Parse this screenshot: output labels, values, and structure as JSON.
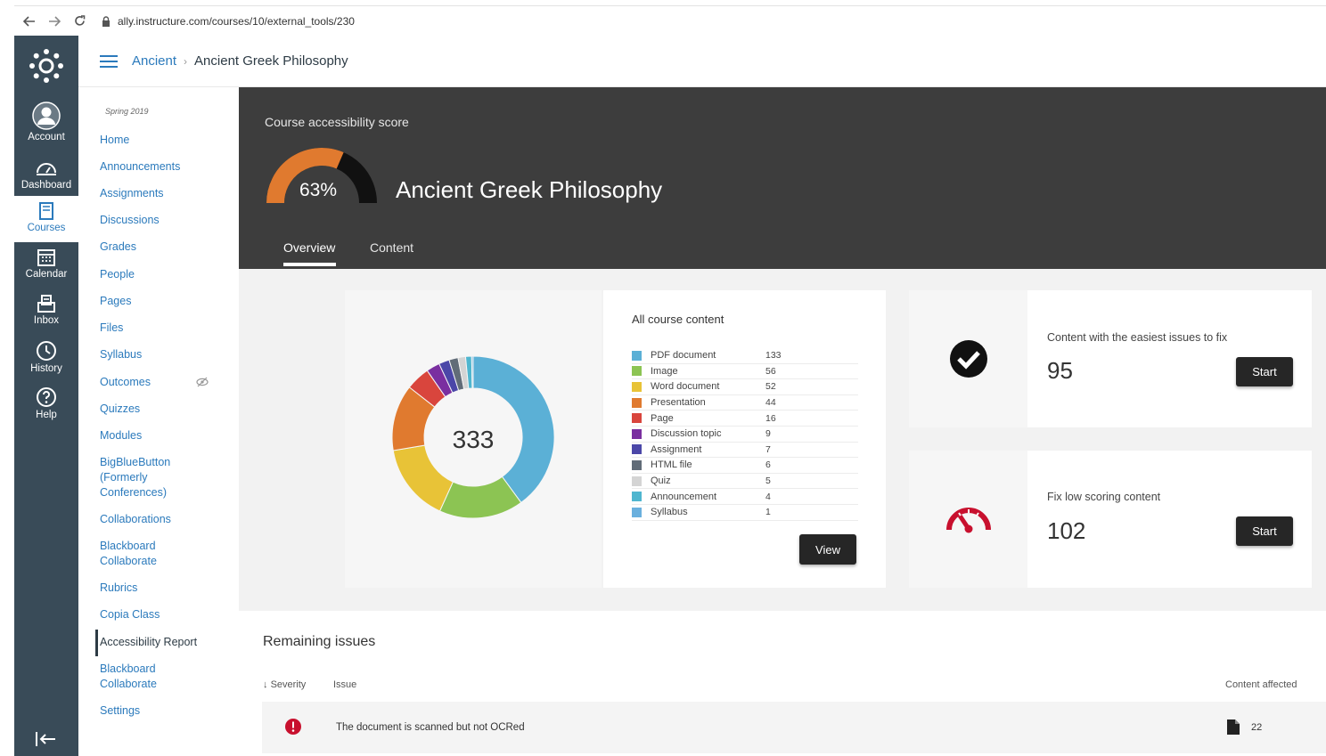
{
  "browser": {
    "url": "ally.instructure.com/courses/10/external_tools/230",
    "back_icon": "back-arrow-icon",
    "forward_icon": "forward-arrow-icon",
    "reload_icon": "reload-icon"
  },
  "global_nav": {
    "items": [
      {
        "label": "Account",
        "icon": "user-icon"
      },
      {
        "label": "Dashboard",
        "icon": "dashboard-icon"
      },
      {
        "label": "Courses",
        "icon": "book-icon",
        "active": true
      },
      {
        "label": "Calendar",
        "icon": "calendar-icon"
      },
      {
        "label": "Inbox",
        "icon": "inbox-icon"
      },
      {
        "label": "History",
        "icon": "clock-icon"
      },
      {
        "label": "Help",
        "icon": "help-icon"
      }
    ]
  },
  "breadcrumb": {
    "course": "Ancient",
    "separator": "›",
    "current": "Ancient Greek Philosophy"
  },
  "course_nav": {
    "term": "Spring 2019",
    "items": [
      {
        "label": "Home"
      },
      {
        "label": "Announcements"
      },
      {
        "label": "Assignments"
      },
      {
        "label": "Discussions"
      },
      {
        "label": "Grades"
      },
      {
        "label": "People"
      },
      {
        "label": "Pages"
      },
      {
        "label": "Files"
      },
      {
        "label": "Syllabus"
      },
      {
        "label": "Outcomes"
      },
      {
        "label": "Quizzes"
      },
      {
        "label": "Modules"
      },
      {
        "label": "BigBlueButton (Formerly Conferences)"
      },
      {
        "label": "Collaborations"
      },
      {
        "label": "Blackboard Collaborate"
      },
      {
        "label": "Rubrics"
      },
      {
        "label": "Copia Class"
      },
      {
        "label": "Accessibility Report",
        "active": true
      },
      {
        "label": "Blackboard Collaborate"
      },
      {
        "label": "Settings"
      }
    ]
  },
  "report": {
    "score_label": "Course accessibility score",
    "score_value": "63%",
    "score_fraction": 0.63,
    "course_title": "Ancient Greek Philosophy",
    "tabs": [
      {
        "label": "Overview",
        "active": true
      },
      {
        "label": "Content"
      }
    ]
  },
  "content_summary": {
    "title": "All course content",
    "total": "333",
    "view_label": "View",
    "items": [
      {
        "name": "PDF document",
        "count": "133",
        "color": "#5bb0d6"
      },
      {
        "name": "Image",
        "count": "56",
        "color": "#8cc453"
      },
      {
        "name": "Word document",
        "count": "52",
        "color": "#e8c337"
      },
      {
        "name": "Presentation",
        "count": "44",
        "color": "#e07a2f"
      },
      {
        "name": "Page",
        "count": "16",
        "color": "#d9453d"
      },
      {
        "name": "Discussion topic",
        "count": "9",
        "color": "#7a2fa0"
      },
      {
        "name": "Assignment",
        "count": "7",
        "color": "#4b47a8"
      },
      {
        "name": "HTML file",
        "count": "6",
        "color": "#616c78"
      },
      {
        "name": "Quiz",
        "count": "5",
        "color": "#d4d4d4"
      },
      {
        "name": "Announcement",
        "count": "4",
        "color": "#4fb6cf"
      },
      {
        "name": "Syllabus",
        "count": "1",
        "color": "#6ab0de"
      }
    ]
  },
  "tasks": [
    {
      "label": "Content with the easiest issues to fix",
      "value": "95",
      "button": "Start",
      "icon": "check-circle-icon"
    },
    {
      "label": "Fix low scoring content",
      "value": "102",
      "button": "Start",
      "icon": "speedometer-icon"
    }
  ],
  "remaining": {
    "title": "Remaining issues",
    "col_severity": "Severity",
    "col_issue": "Issue",
    "col_affected": "Content affected",
    "issues": [
      {
        "text": "The document is scanned but not OCRed",
        "count": "22"
      }
    ]
  },
  "colors": {
    "canvas_nav": "#394b58",
    "link": "#2b7abc",
    "ally_dark": "#3d3d3d",
    "gauge_orange": "#e07a2f",
    "severity_red": "#c8102e"
  }
}
